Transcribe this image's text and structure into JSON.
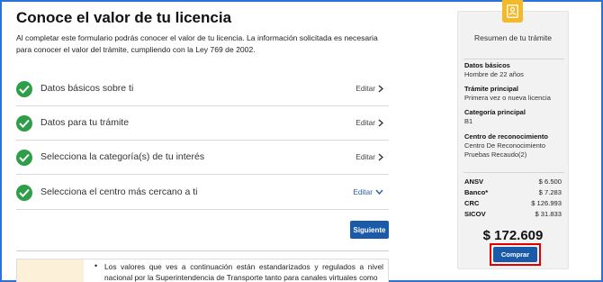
{
  "page": {
    "title": "Conoce el valor de tu licencia",
    "intro": "Al completar este formulario podrás conocer el valor de tu licencia. La información solicitada es necesaria para conocer el valor del trámite, cumpliendo con la Ley 769 de 2002."
  },
  "steps": [
    {
      "label": "Datos básicos sobre ti",
      "edit_label": "Editar",
      "chevron": "chevron-right-icon"
    },
    {
      "label": "Datos para tu trámite",
      "edit_label": "Editar",
      "chevron": "chevron-right-icon"
    },
    {
      "label": "Selecciona la categoría(s) de tu interés",
      "edit_label": "Editar",
      "chevron": "chevron-right-icon"
    },
    {
      "label": "Selecciona el centro más cercano a ti",
      "edit_label": "Editar",
      "chevron": "chevron-down-icon"
    }
  ],
  "next_button": "Siguiente",
  "notice": {
    "text": "Los valores que ves a continuación están estandarizados y regulados a nivel nacional por la Superintendencia de Transporte tanto para canales virtuales como"
  },
  "summary": {
    "title": "Resumen de tu trámite",
    "fields": [
      {
        "heading": "Datos básicos",
        "value": "Hombre de 22 años"
      },
      {
        "heading": "Trámite principal",
        "value": "Primera vez o nueva licencia"
      },
      {
        "heading": "Categoría principal",
        "value": "B1"
      },
      {
        "heading": "Centro de reconocimiento",
        "value": "Centro De Reconocimiento Pruebas Recaudo(2)"
      }
    ],
    "costs": [
      {
        "name": "ANSV",
        "amount": "$ 6.500"
      },
      {
        "name": "Banco*",
        "amount": "$ 7.283"
      },
      {
        "name": "CRC",
        "amount": "$ 126.993"
      },
      {
        "name": "SICOV",
        "amount": "$ 31.833"
      }
    ],
    "total": "$ 172.609",
    "buy_button": "Comprar"
  },
  "colors": {
    "check_green": "#2e9e48",
    "primary_blue": "#1a5aa8",
    "highlight_red": "#e00000",
    "badge_yellow": "#f4b928"
  }
}
